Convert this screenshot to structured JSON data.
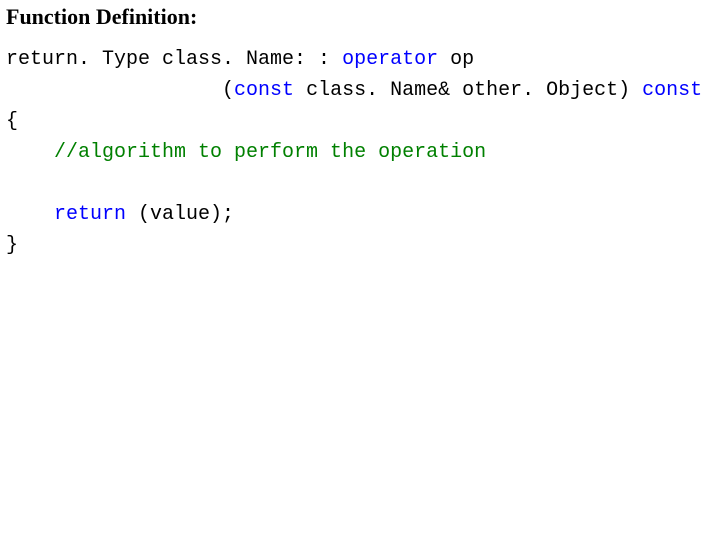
{
  "heading": {
    "bold": "Function Definition",
    "colon": ":"
  },
  "code": {
    "l1_a": "return. Type class. Name: : ",
    "l1_op": "operator",
    "l1_b": " op",
    "l2_pad": "                  (",
    "l2_const1": "const",
    "l2_mid": " class. Name& other. Object) ",
    "l2_const2": "const",
    "l3": "{",
    "l4_pad": "    ",
    "l4_cmt": "//algorithm to perform the operation",
    "l5": "",
    "l6_pad": "    ",
    "l6_ret": "return",
    "l6_rest": " (value);",
    "l7": "}"
  }
}
